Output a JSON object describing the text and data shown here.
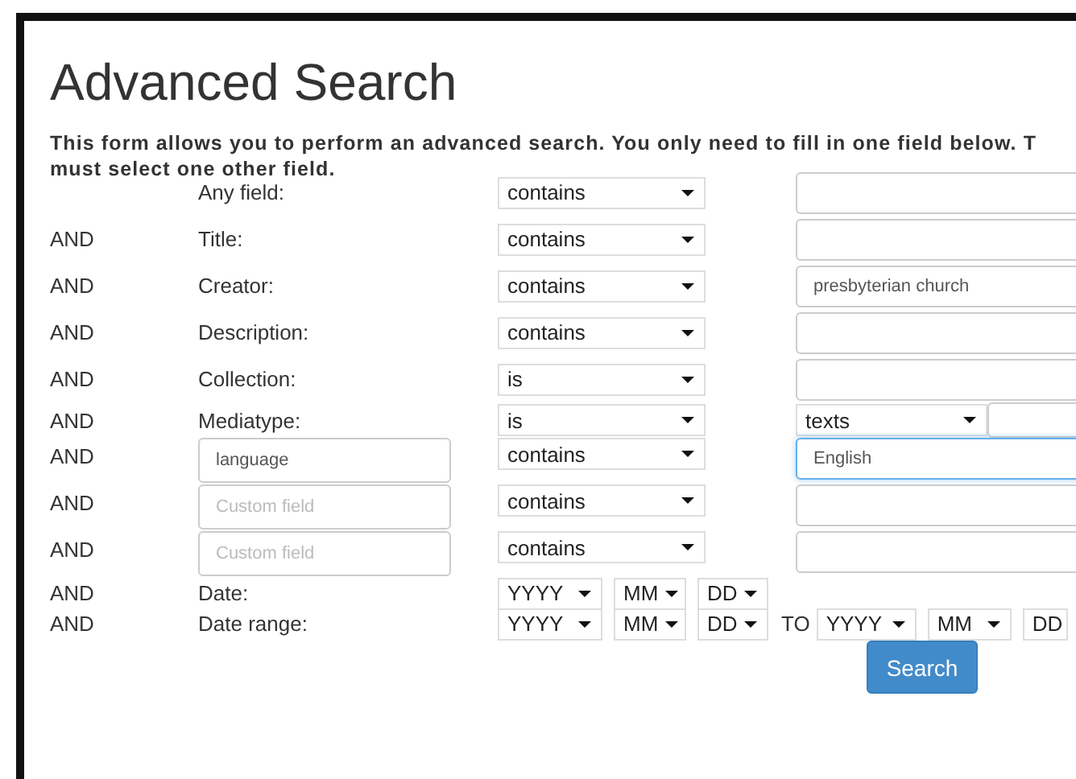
{
  "title": "Advanced Search",
  "intro": "This form allows you to perform an advanced search. You only need to fill in one field below. T must select one other field.",
  "rows": [
    {
      "kind": "field",
      "label": "Any field:",
      "operator": "contains",
      "value": {
        "kind": "input"
      }
    },
    {
      "kind": "field",
      "conjunction": "AND",
      "label": "Title:",
      "operator": "contains",
      "value": {
        "kind": "input"
      }
    },
    {
      "kind": "field",
      "conjunction": "AND",
      "label": "Creator:",
      "operator": "contains",
      "value": {
        "kind": "input",
        "text": "presbyterian church"
      }
    },
    {
      "kind": "field",
      "conjunction": "AND",
      "label": "Description:",
      "operator": "contains",
      "value": {
        "kind": "input"
      }
    },
    {
      "kind": "field",
      "conjunction": "AND",
      "label": "Collection:",
      "operator": "is",
      "value": {
        "kind": "input"
      }
    },
    {
      "kind": "field",
      "conjunction": "AND",
      "label": "Mediatype:",
      "operator": "is",
      "value": {
        "kind": "select",
        "text": "texts"
      }
    },
    {
      "kind": "custom",
      "conjunction": "AND",
      "field": {
        "text": "language"
      },
      "operator": "contains",
      "value": {
        "kind": "input",
        "text": "English",
        "focused": true
      }
    },
    {
      "kind": "custom",
      "conjunction": "AND",
      "field": {
        "placeholder": "Custom field"
      },
      "operator": "contains",
      "value": {
        "kind": "input"
      }
    },
    {
      "kind": "custom",
      "conjunction": "AND",
      "field": {
        "placeholder": "Custom field"
      },
      "operator": "contains",
      "value": {
        "kind": "input"
      }
    },
    {
      "kind": "date",
      "conjunction": "AND",
      "label": "Date:",
      "from": [
        "YYYY",
        "MM",
        "DD"
      ]
    },
    {
      "kind": "range",
      "conjunction": "AND",
      "label": "Date range:",
      "from": [
        "YYYY",
        "MM",
        "DD"
      ],
      "joiner": "TO",
      "to": [
        "YYYY",
        "MM",
        "DD"
      ]
    }
  ],
  "search_button": "Search"
}
